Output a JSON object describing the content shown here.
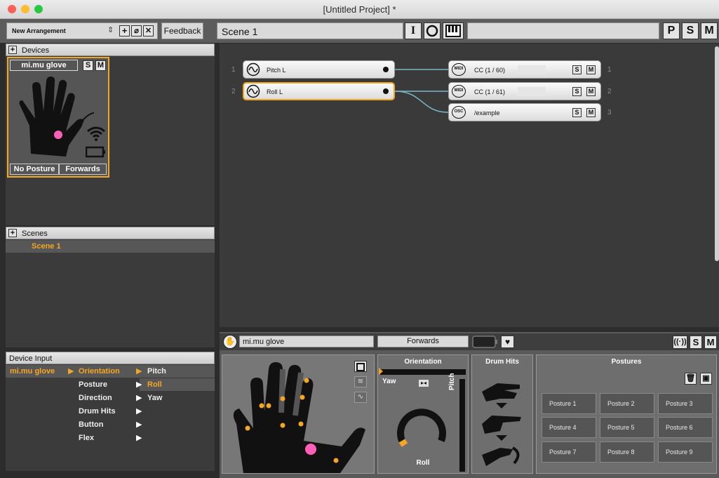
{
  "window": {
    "title": "[Untitled Project] *"
  },
  "colors": {
    "accent": "#f5a623",
    "link_line": "#7ab8c8",
    "pink": "#ff5fb8"
  },
  "toolbar": {
    "arrangement": "New Arrangement",
    "feedback": "Feedback",
    "scene_name": "Scene 1",
    "btn_i": "I",
    "btn_p": "P",
    "btn_s": "S",
    "btn_m": "M"
  },
  "devices": {
    "header": "Devices",
    "add": "+",
    "device_name": "mi.mu glove",
    "solo": "S",
    "mute": "M",
    "posture": "No Posture",
    "direction": "Forwards"
  },
  "scenes": {
    "header": "Scenes",
    "add": "+",
    "items": [
      "Scene 1"
    ]
  },
  "routing": {
    "inputs": [
      {
        "num": "1",
        "label": "Pitch L"
      },
      {
        "num": "2",
        "label": "Roll L"
      }
    ],
    "outputs": [
      {
        "num": "1",
        "type": "MIDI",
        "label": "CC (1 / 60)",
        "s": "S",
        "m": "M"
      },
      {
        "num": "2",
        "type": "MIDI",
        "label": "CC (1 / 61)",
        "s": "S",
        "m": "M"
      },
      {
        "num": "3",
        "type": "OSC",
        "label": "/example",
        "s": "S",
        "m": "M"
      }
    ]
  },
  "device_input": {
    "header": "Device Input",
    "device": "mi.mu glove",
    "categories": [
      "Orientation",
      "Posture",
      "Direction",
      "Drum Hits",
      "Button",
      "Flex"
    ],
    "sub_items": [
      "Pitch",
      "Roll",
      "Yaw"
    ]
  },
  "glove_panel": {
    "device_name": "mi.mu glove",
    "direction": "Forwards",
    "s": "S",
    "m": "M",
    "orientation": {
      "title": "Orientation",
      "yaw": "Yaw",
      "pitch": "Pitch",
      "roll": "Roll"
    },
    "drum_hits": {
      "title": "Drum Hits"
    },
    "postures": {
      "title": "Postures",
      "items": [
        "Posture 1",
        "Posture 2",
        "Posture 3",
        "Posture 4",
        "Posture 5",
        "Posture 6",
        "Posture 7",
        "Posture 8",
        "Posture 9"
      ]
    }
  }
}
